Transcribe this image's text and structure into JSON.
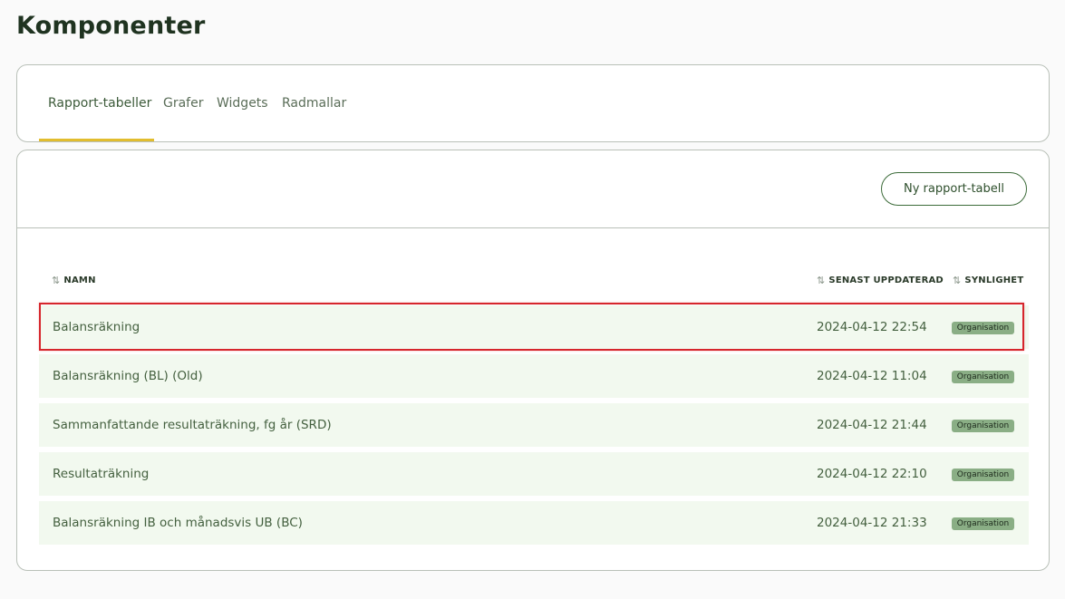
{
  "page": {
    "title": "Komponenter"
  },
  "tabs": [
    {
      "label": "Rapport-tabeller",
      "active": true
    },
    {
      "label": "Grafer",
      "active": false
    },
    {
      "label": "Widgets",
      "active": false
    },
    {
      "label": "Radmallar",
      "active": false
    }
  ],
  "toolbar": {
    "new_button_label": "Ny rapport-tabell"
  },
  "table": {
    "headers": {
      "name": "NAMN",
      "updated": "SENAST UPPDATERAD",
      "visibility": "SYNLIGHET",
      "sort_icon": "sort-arrows-icon"
    },
    "rows": [
      {
        "name": "Balansräkning",
        "updated": "2024-04-12 22:54",
        "visibility": "Organisation",
        "highlighted": true
      },
      {
        "name": "Balansräkning (BL) (Old)",
        "updated": "2024-04-12 11:04",
        "visibility": "Organisation"
      },
      {
        "name": "Sammanfattande resultaträkning, fg år (SRD)",
        "updated": "2024-04-12 21:44",
        "visibility": "Organisation"
      },
      {
        "name": "Resultaträkning",
        "updated": "2024-04-12 22:10",
        "visibility": "Organisation"
      },
      {
        "name": "Balansräkning IB och månadsvis UB (BC)",
        "updated": "2024-04-12 21:33",
        "visibility": "Organisation"
      }
    ]
  },
  "colors": {
    "accent_underline": "#e2bd2e",
    "row_background": "#f2f9ef",
    "badge": "#8aae85",
    "highlight_border": "#d6262c"
  }
}
